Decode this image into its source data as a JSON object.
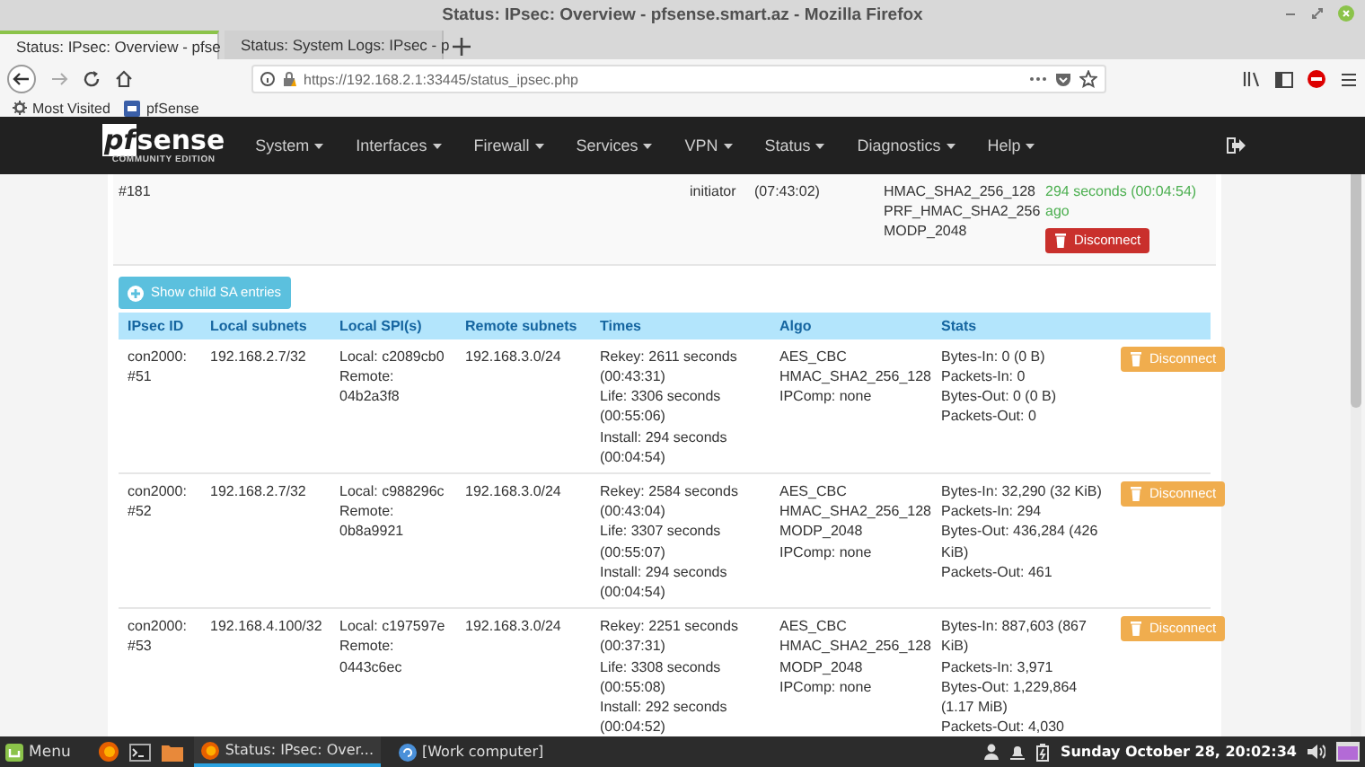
{
  "window": {
    "title": "Status: IPsec: Overview - pfsense.smart.az - Mozilla Firefox"
  },
  "tabs": [
    {
      "label": "Status: IPsec: Overview - pfse",
      "selected": true
    },
    {
      "label": "Status: System Logs: IPsec - p",
      "selected": false
    }
  ],
  "address_bar": {
    "url": "https://192.168.2.1:33445/status_ipsec.php"
  },
  "bookmarks": [
    "Most Visited",
    "pfSense"
  ],
  "navbar": {
    "logo_prefix": "pf",
    "logo": "sense",
    "logo_subtitle": "COMMUNITY EDITION",
    "menus": [
      "System",
      "Interfaces",
      "Firewall",
      "Services",
      "VPN",
      "Status",
      "Diagnostics",
      "Help"
    ]
  },
  "parent_sa": {
    "id": "#181",
    "role": "initiator",
    "time": "(07:43:02)",
    "algo": [
      "HMAC_SHA2_256_128",
      "PRF_HMAC_SHA2_256",
      "MODP_2048"
    ],
    "status": "294 seconds (00:04:54) ago",
    "action": {
      "label": "Disconnect",
      "kind": "danger"
    }
  },
  "child_toggle": {
    "label": "Show child SA entries"
  },
  "child_sa_table": {
    "columns": [
      "IPsec ID",
      "Local subnets",
      "Local SPI(s)",
      "Remote subnets",
      "Times",
      "Algo",
      "Stats"
    ],
    "rows": [
      {
        "ipsec_id": "con2000: #51",
        "local_subnets": "192.168.2.7/32",
        "local_spi": [
          "Local: c2089cb0",
          "Remote: 04b2a3f8"
        ],
        "remote_subnets": "192.168.3.0/24",
        "times": [
          "Rekey: 2611 seconds (00:43:31)",
          "Life: 3306 seconds (00:55:06)",
          "Install: 294 seconds (00:04:54)"
        ],
        "algo": [
          "AES_CBC",
          "HMAC_SHA2_256_128",
          "IPComp: none"
        ],
        "stats": [
          "Bytes-In: 0 (0 B)",
          "Packets-In: 0",
          "Bytes-Out: 0 (0 B)",
          "Packets-Out: 0"
        ],
        "action": {
          "label": "Disconnect",
          "kind": "warning"
        }
      },
      {
        "ipsec_id": "con2000: #52",
        "local_subnets": "192.168.2.7/32",
        "local_spi": [
          "Local: c988296c",
          "Remote: 0b8a9921"
        ],
        "remote_subnets": "192.168.3.0/24",
        "times": [
          "Rekey: 2584 seconds (00:43:04)",
          "Life: 3307 seconds (00:55:07)",
          "Install: 294 seconds (00:04:54)"
        ],
        "algo": [
          "AES_CBC",
          "HMAC_SHA2_256_128",
          "MODP_2048",
          "IPComp: none"
        ],
        "stats": [
          "Bytes-In: 32,290 (32 KiB)",
          "Packets-In: 294",
          "Bytes-Out: 436,284 (426 KiB)",
          "Packets-Out: 461"
        ],
        "action": {
          "label": "Disconnect",
          "kind": "warning"
        }
      },
      {
        "ipsec_id": "con2000: #53",
        "local_subnets": "192.168.4.100/32",
        "local_spi": [
          "Local: c197597e",
          "Remote: 0443c6ec"
        ],
        "remote_subnets": "192.168.3.0/24",
        "times": [
          "Rekey: 2251 seconds (00:37:31)",
          "Life: 3308 seconds (00:55:08)",
          "Install: 292 seconds (00:04:52)"
        ],
        "algo": [
          "AES_CBC",
          "HMAC_SHA2_256_128",
          "MODP_2048",
          "IPComp: none"
        ],
        "stats": [
          "Bytes-In: 887,603 (867 KiB)",
          "Packets-In: 3,971",
          "Bytes-Out: 1,229,864 (1.17 MiB)",
          "Packets-Out: 4,030"
        ],
        "action": {
          "label": "Disconnect",
          "kind": "warning"
        }
      }
    ]
  },
  "taskbar": {
    "menu": "Menu",
    "windows": [
      {
        "label": "Status: IPsec: Over...",
        "selected": true
      },
      {
        "label": "[Work computer]",
        "selected": false
      }
    ],
    "clock": "Sunday October 28, 20:02:34"
  }
}
